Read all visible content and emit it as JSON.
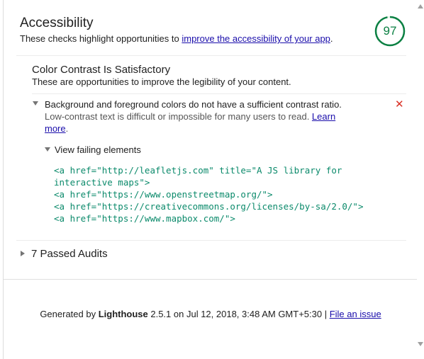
{
  "category": {
    "title": "Accessibility",
    "description_prefix": "These checks highlight opportunities to ",
    "description_link": "improve the accessibility of your app",
    "description_suffix": ".",
    "score": "97",
    "score_color": "#0b8043"
  },
  "group": {
    "title": "Color Contrast Is Satisfactory",
    "description": "These are opportunities to improve the legibility of your content."
  },
  "audit": {
    "title": "Background and foreground colors do not have a sufficient contrast ratio.",
    "help_text": "Low-contrast text is difficult or impossible for many users to read. ",
    "learn_more": "Learn more",
    "learn_more_suffix": ".",
    "status_icon": "fail-x-icon",
    "status_color": "#d93025",
    "details_label": "View failing elements",
    "failing_elements": [
      "<a href=\"http://leafletjs.com\" title=\"A JS library for interactive maps\">",
      "<a href=\"https://www.openstreetmap.org/\">",
      "<a href=\"https://creativecommons.org/licenses/by-sa/2.0/\">",
      "<a href=\"https://www.mapbox.com/\">"
    ]
  },
  "passed_audits": {
    "label": "7 Passed Audits"
  },
  "footer": {
    "generated_by": "Generated by ",
    "tool_name": "Lighthouse",
    "version_text": " 2.5.1 on Jul 12, 2018, 3:48 AM GMT+5:30 | ",
    "issue_link": "File an issue"
  }
}
